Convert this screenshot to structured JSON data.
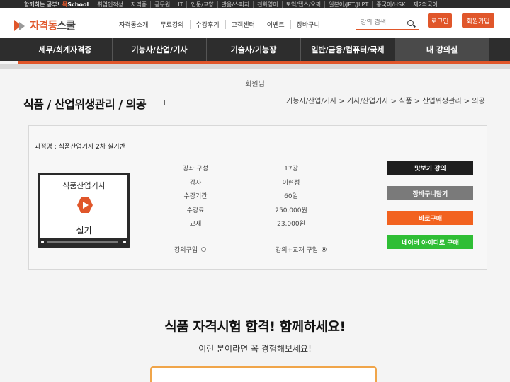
{
  "topstrip": {
    "brand": "함께하는 공부!",
    "school_prefix": "목",
    "school": "School",
    "links": [
      "취업인적성",
      "자격증",
      "공무원",
      "IT",
      "인문/교양",
      "발음/스피치",
      "전화영어",
      "토익/텝스/오픽",
      "일본어/JPT/JLPT",
      "중국어/HSK",
      "제2외국어"
    ]
  },
  "header": {
    "logo_main": "자격동",
    "logo_sub": "스쿨",
    "menu": [
      "자격동소개",
      "무료강의",
      "수강후기",
      "고객센터",
      "이벤트",
      "장바구니"
    ],
    "search_placeholder": "강의 검색",
    "login_label": "로그인",
    "join_label": "회원가입"
  },
  "mainnav": [
    "세무/회계자격증",
    "기능사/산업/기사",
    "기술사/기능장",
    "일반/금융/컴퓨터/국제",
    "내 강의실"
  ],
  "welcome": "회원님",
  "page": {
    "title": "식품 / 산업위생관리 / 의공",
    "breadcrumb": "기능사/산업/기사 > 기사/산업기사 > 식품 > 산업위생관리 > 의공"
  },
  "course": {
    "name_label": "과정명 : 식품산업기사 2차 실기반",
    "thumb_title": "식품산업기사",
    "thumb_sub": "실기",
    "info": [
      {
        "label": "강좌 구성",
        "value": "17강"
      },
      {
        "label": "강사",
        "value": "이현정"
      },
      {
        "label": "수강기간",
        "value": "60일"
      },
      {
        "label": "수강료",
        "value": "250,000원"
      },
      {
        "label": "교재",
        "value": "23,000원"
      }
    ],
    "options": [
      {
        "label": "강의구입",
        "checked": false
      },
      {
        "label": "강의+교재 구입",
        "checked": true
      }
    ],
    "buttons": [
      {
        "label": "맛보기 강의",
        "color": "#1e1e1e"
      },
      {
        "label": "장바구니담기",
        "color": "#7a7a7a"
      },
      {
        "label": "바로구매",
        "color": "#f2621f"
      },
      {
        "label": "네이버 아이디로 구매",
        "color": "#2fbe35"
      }
    ]
  },
  "promo": {
    "title": "식품 자격시험 합격! 함께하세요!",
    "subtitle": "이런 분이라면 꼭 경험해보세요!"
  },
  "colors": {
    "accent": "#e0562a",
    "nav_bg": "#2d2d2d"
  }
}
